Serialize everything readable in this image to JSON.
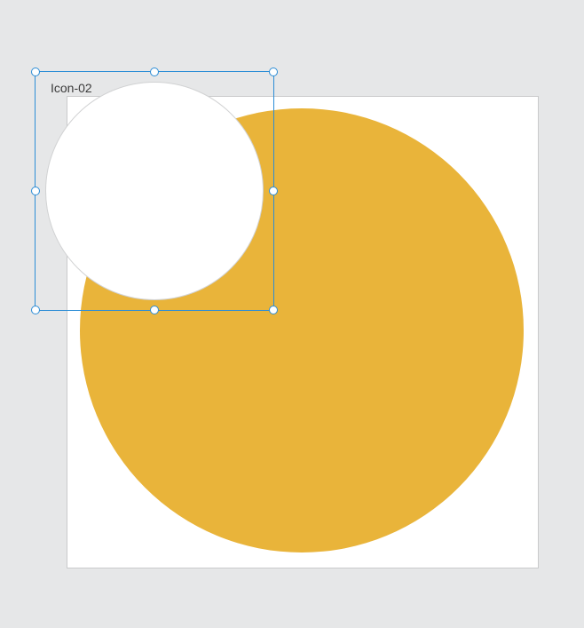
{
  "canvas": {
    "background_color": "#e6e7e8"
  },
  "artboard": {
    "border_color": "#c9cacb",
    "fill": "#ffffff"
  },
  "shapes": {
    "big_circle": {
      "fill": "#e9b43a",
      "type": "ellipse"
    }
  },
  "selection": {
    "layer_name": "Icon-02",
    "outline_color": "#2c8dd6",
    "handle_fill": "#ffffff",
    "shape": {
      "type": "ellipse",
      "fill": "#ffffff"
    }
  }
}
